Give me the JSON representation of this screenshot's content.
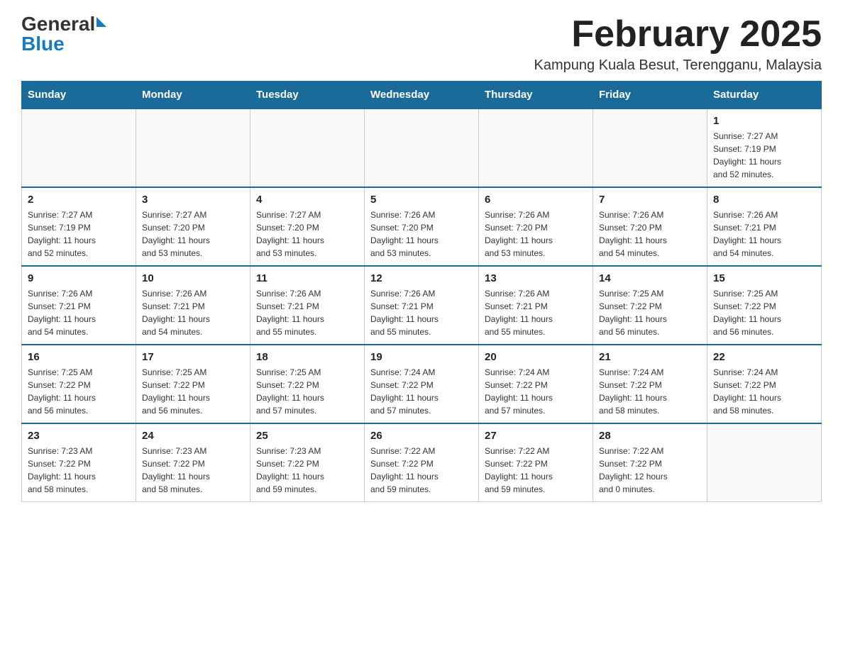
{
  "header": {
    "logo_general": "General",
    "logo_blue": "Blue",
    "month_title": "February 2025",
    "location": "Kampung Kuala Besut, Terengganu, Malaysia"
  },
  "days_of_week": [
    "Sunday",
    "Monday",
    "Tuesday",
    "Wednesday",
    "Thursday",
    "Friday",
    "Saturday"
  ],
  "weeks": [
    {
      "days": [
        {
          "number": "",
          "info": ""
        },
        {
          "number": "",
          "info": ""
        },
        {
          "number": "",
          "info": ""
        },
        {
          "number": "",
          "info": ""
        },
        {
          "number": "",
          "info": ""
        },
        {
          "number": "",
          "info": ""
        },
        {
          "number": "1",
          "info": "Sunrise: 7:27 AM\nSunset: 7:19 PM\nDaylight: 11 hours\nand 52 minutes."
        }
      ]
    },
    {
      "days": [
        {
          "number": "2",
          "info": "Sunrise: 7:27 AM\nSunset: 7:19 PM\nDaylight: 11 hours\nand 52 minutes."
        },
        {
          "number": "3",
          "info": "Sunrise: 7:27 AM\nSunset: 7:20 PM\nDaylight: 11 hours\nand 53 minutes."
        },
        {
          "number": "4",
          "info": "Sunrise: 7:27 AM\nSunset: 7:20 PM\nDaylight: 11 hours\nand 53 minutes."
        },
        {
          "number": "5",
          "info": "Sunrise: 7:26 AM\nSunset: 7:20 PM\nDaylight: 11 hours\nand 53 minutes."
        },
        {
          "number": "6",
          "info": "Sunrise: 7:26 AM\nSunset: 7:20 PM\nDaylight: 11 hours\nand 53 minutes."
        },
        {
          "number": "7",
          "info": "Sunrise: 7:26 AM\nSunset: 7:20 PM\nDaylight: 11 hours\nand 54 minutes."
        },
        {
          "number": "8",
          "info": "Sunrise: 7:26 AM\nSunset: 7:21 PM\nDaylight: 11 hours\nand 54 minutes."
        }
      ]
    },
    {
      "days": [
        {
          "number": "9",
          "info": "Sunrise: 7:26 AM\nSunset: 7:21 PM\nDaylight: 11 hours\nand 54 minutes."
        },
        {
          "number": "10",
          "info": "Sunrise: 7:26 AM\nSunset: 7:21 PM\nDaylight: 11 hours\nand 54 minutes."
        },
        {
          "number": "11",
          "info": "Sunrise: 7:26 AM\nSunset: 7:21 PM\nDaylight: 11 hours\nand 55 minutes."
        },
        {
          "number": "12",
          "info": "Sunrise: 7:26 AM\nSunset: 7:21 PM\nDaylight: 11 hours\nand 55 minutes."
        },
        {
          "number": "13",
          "info": "Sunrise: 7:26 AM\nSunset: 7:21 PM\nDaylight: 11 hours\nand 55 minutes."
        },
        {
          "number": "14",
          "info": "Sunrise: 7:25 AM\nSunset: 7:22 PM\nDaylight: 11 hours\nand 56 minutes."
        },
        {
          "number": "15",
          "info": "Sunrise: 7:25 AM\nSunset: 7:22 PM\nDaylight: 11 hours\nand 56 minutes."
        }
      ]
    },
    {
      "days": [
        {
          "number": "16",
          "info": "Sunrise: 7:25 AM\nSunset: 7:22 PM\nDaylight: 11 hours\nand 56 minutes."
        },
        {
          "number": "17",
          "info": "Sunrise: 7:25 AM\nSunset: 7:22 PM\nDaylight: 11 hours\nand 56 minutes."
        },
        {
          "number": "18",
          "info": "Sunrise: 7:25 AM\nSunset: 7:22 PM\nDaylight: 11 hours\nand 57 minutes."
        },
        {
          "number": "19",
          "info": "Sunrise: 7:24 AM\nSunset: 7:22 PM\nDaylight: 11 hours\nand 57 minutes."
        },
        {
          "number": "20",
          "info": "Sunrise: 7:24 AM\nSunset: 7:22 PM\nDaylight: 11 hours\nand 57 minutes."
        },
        {
          "number": "21",
          "info": "Sunrise: 7:24 AM\nSunset: 7:22 PM\nDaylight: 11 hours\nand 58 minutes."
        },
        {
          "number": "22",
          "info": "Sunrise: 7:24 AM\nSunset: 7:22 PM\nDaylight: 11 hours\nand 58 minutes."
        }
      ]
    },
    {
      "days": [
        {
          "number": "23",
          "info": "Sunrise: 7:23 AM\nSunset: 7:22 PM\nDaylight: 11 hours\nand 58 minutes."
        },
        {
          "number": "24",
          "info": "Sunrise: 7:23 AM\nSunset: 7:22 PM\nDaylight: 11 hours\nand 58 minutes."
        },
        {
          "number": "25",
          "info": "Sunrise: 7:23 AM\nSunset: 7:22 PM\nDaylight: 11 hours\nand 59 minutes."
        },
        {
          "number": "26",
          "info": "Sunrise: 7:22 AM\nSunset: 7:22 PM\nDaylight: 11 hours\nand 59 minutes."
        },
        {
          "number": "27",
          "info": "Sunrise: 7:22 AM\nSunset: 7:22 PM\nDaylight: 11 hours\nand 59 minutes."
        },
        {
          "number": "28",
          "info": "Sunrise: 7:22 AM\nSunset: 7:22 PM\nDaylight: 12 hours\nand 0 minutes."
        },
        {
          "number": "",
          "info": ""
        }
      ]
    }
  ]
}
